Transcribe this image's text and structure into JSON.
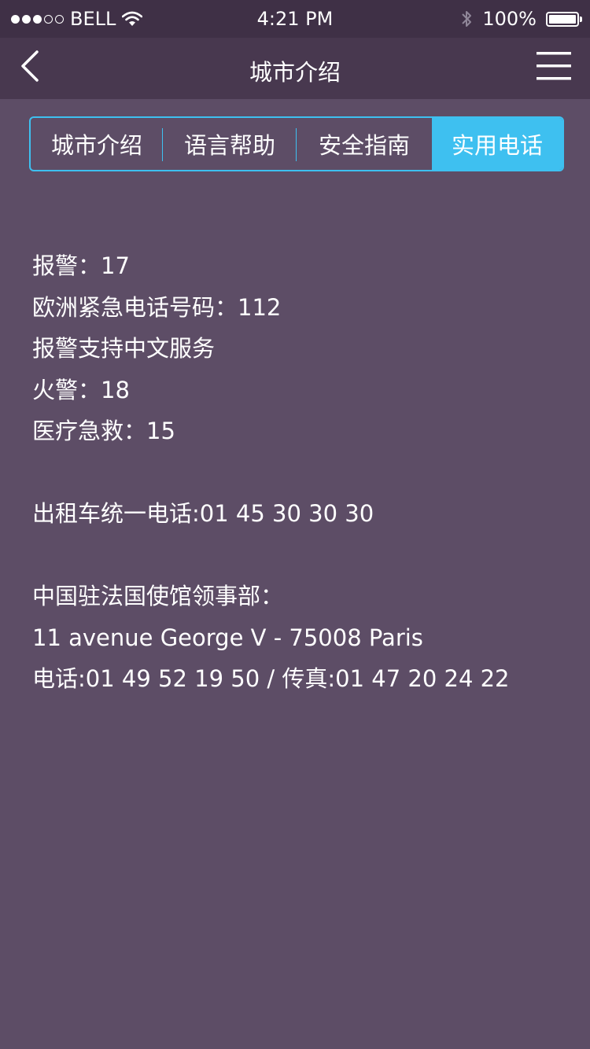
{
  "status_bar": {
    "carrier": "BELL",
    "time": "4:21 PM",
    "battery": "100%",
    "signal_bars_filled": 3,
    "signal_bars_total": 5
  },
  "nav": {
    "title": "城市介绍",
    "back_icon": "chevron-left-icon",
    "menu_icon": "hamburger-menu-icon"
  },
  "tabs": [
    {
      "label": "城市介绍",
      "active": false
    },
    {
      "label": "语言帮助",
      "active": false
    },
    {
      "label": "安全指南",
      "active": false
    },
    {
      "label": "实用电话",
      "active": true
    }
  ],
  "colors": {
    "accent": "#3ec0f0",
    "background": "#5d4d66",
    "nav_background": "#48384f",
    "status_background": "#3f3046"
  },
  "content": {
    "lines": [
      "报警：17",
      "欧洲紧急电话号码：112",
      "报警支持中文服务",
      "火警：18",
      "医疗急救：15",
      "",
      "出租车统一电话:01 45 30 30 30",
      "",
      "中国驻法国使馆领事部：",
      "11 avenue George V - 75008 Paris",
      "电话:01 49 52 19 50 / 传真:01 47 20 24 22"
    ]
  }
}
